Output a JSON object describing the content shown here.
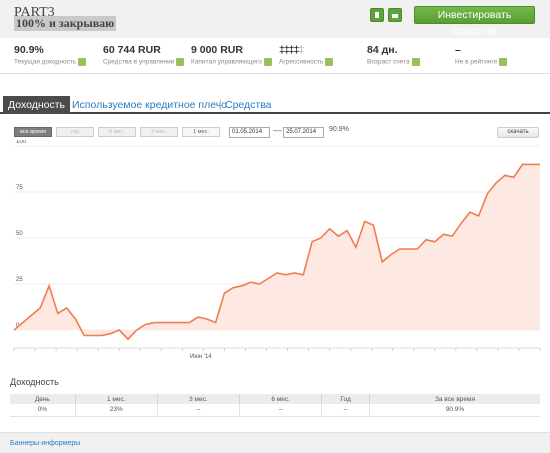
{
  "header": {
    "title": "PART3",
    "subtitle": "100% и закрываю",
    "invest_label": "Инвестировать средства"
  },
  "stats": [
    {
      "value": "90.9%",
      "label": "Текущая доходность"
    },
    {
      "value": "60 744 RUR",
      "label": "Средства в управлении"
    },
    {
      "value": "9 000 RUR",
      "label": "Капитал управляющего"
    },
    {
      "value": "",
      "label": "Агрессивность"
    },
    {
      "value": "84 дн.",
      "label": "Возраст счета"
    },
    {
      "value": "–",
      "label": "Не в рейтинге"
    }
  ],
  "aggressiveness": {
    "level": 4,
    "max": 5
  },
  "tabs": {
    "active": "Доходность",
    "other": [
      "Используемое кредитное плечо",
      "Средства"
    ]
  },
  "toolbar": {
    "periods": [
      "все время",
      "год",
      "6 мес.",
      "3 мес.",
      "1 мес."
    ],
    "date_from": "01.05.2014",
    "date_to": "25.07.2014",
    "dash": "—",
    "total": "90.9%",
    "download": "скачать"
  },
  "colors": {
    "accent_green": "#5ea23c",
    "line": "#f07c50",
    "area": "#fde9e1",
    "link": "#2e7bbf",
    "flame": "#e8582b"
  },
  "chart_data": {
    "type": "area",
    "xlabel": "",
    "ylabel": "",
    "ylim": [
      0,
      100
    ],
    "yticks": [
      0,
      25,
      50,
      75,
      100
    ],
    "x_tick_label": "Июн '14",
    "values": [
      0,
      4,
      8,
      12,
      24,
      9,
      12,
      6,
      -3,
      -3,
      -3,
      -2,
      0,
      -5,
      0,
      3,
      4,
      4,
      4,
      4,
      4,
      7,
      6,
      4,
      20,
      23,
      24,
      26,
      25,
      28,
      31,
      30,
      31,
      30,
      48,
      50,
      55,
      51,
      54,
      45,
      59,
      57,
      37,
      41,
      44,
      44,
      44,
      49,
      48,
      52,
      51,
      58,
      64,
      62,
      74,
      80,
      84,
      83,
      90,
      90,
      90
    ]
  },
  "returns": {
    "title": "Доходность",
    "headers": [
      "День",
      "1 мес.",
      "3 мес.",
      "6 мес.",
      "Год",
      "За все время"
    ],
    "values": [
      "0%",
      "23%",
      "–",
      "–",
      "–",
      "90.9%"
    ]
  },
  "footer": {
    "link": "Баннеры-информеры"
  }
}
